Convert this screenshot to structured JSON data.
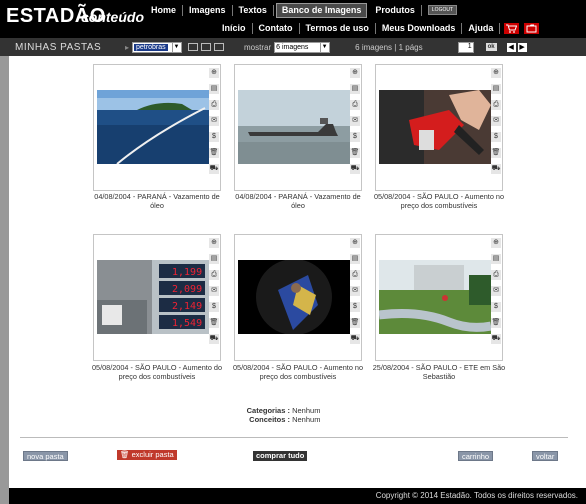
{
  "header": {
    "logo": "ESTADÃO",
    "logo_sub": "conteúdo",
    "nav_top": [
      "Home",
      "Imagens",
      "Textos",
      "Banco de Imagens",
      "Produtos"
    ],
    "logout": "LOGOUT",
    "nav_bottom": [
      "Início",
      "Contato",
      "Termos de uso",
      "Meus Downloads",
      "Ajuda"
    ]
  },
  "toolbar": {
    "title": "MINHAS PASTAS",
    "folder_selected": "petrobras",
    "mostrar_label": "mostrar",
    "qty_selected": "6 imagens",
    "info": "6 imagens | 1 págs",
    "page": "1",
    "ok": "ok"
  },
  "cards": [
    {
      "caption": "04/08/2004 - PARANÁ - Vazamento de óleo"
    },
    {
      "caption": "04/08/2004 - PARANÁ - Vazamento de óleo"
    },
    {
      "caption": "05/08/2004 - SÃO PAULO - Aumento no preço dos combustíveis"
    },
    {
      "caption": "05/08/2004 - SÃO PAULO - Aumento do preço dos combustíveis"
    },
    {
      "caption": "05/08/2004 - SÃO PAULO - Aumento no preço dos combustíveis"
    },
    {
      "caption": "25/08/2004 - SÃO PAULO - ETE em São Sebastião"
    }
  ],
  "pump_prices": [
    "1,199",
    "2,099",
    "2,149",
    "1,549"
  ],
  "categories": {
    "label": "Categorias :",
    "value": "Nenhum"
  },
  "concepts": {
    "label": "Conceitos :",
    "value": "Nenhum"
  },
  "buttons": {
    "nova_pasta": "nova pasta",
    "excluir_pasta": "excluir pasta",
    "comprar_tudo": "comprar tudo",
    "carrinho": "carrinho",
    "voltar": "voltar"
  },
  "footer": "Copyright © 2014 Estadão. Todos os direitos reservados.",
  "colors": {
    "header_bg": "#000000",
    "toolbar_bg": "#333333",
    "accent_red": "#cc0000",
    "button_gray": "#8a96a8"
  }
}
